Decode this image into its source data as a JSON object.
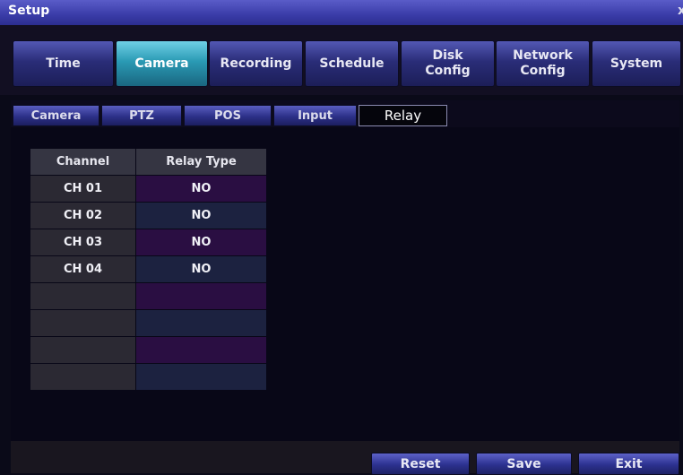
{
  "window": {
    "title": "Setup",
    "close_glyph": "x"
  },
  "main_tabs": [
    {
      "label": "Time",
      "active": false
    },
    {
      "label": "Camera",
      "active": true
    },
    {
      "label": "Recording",
      "active": false
    },
    {
      "label": "Schedule",
      "active": false
    },
    {
      "label": "Disk\nConfig",
      "active": false
    },
    {
      "label": "Network\nConfig",
      "active": false
    },
    {
      "label": "System",
      "active": false
    }
  ],
  "sub_tabs": [
    {
      "label": "Camera",
      "active": false
    },
    {
      "label": "PTZ",
      "active": false
    },
    {
      "label": "POS",
      "active": false
    },
    {
      "label": "Input",
      "active": false
    },
    {
      "label": "Relay",
      "active": true
    }
  ],
  "relay_table": {
    "headers": {
      "channel": "Channel",
      "relay_type": "Relay Type"
    },
    "rows": [
      {
        "channel": "CH 01",
        "relay_type": "NO"
      },
      {
        "channel": "CH 02",
        "relay_type": "NO"
      },
      {
        "channel": "CH 03",
        "relay_type": "NO"
      },
      {
        "channel": "CH 04",
        "relay_type": "NO"
      },
      {
        "channel": "",
        "relay_type": ""
      },
      {
        "channel": "",
        "relay_type": ""
      },
      {
        "channel": "",
        "relay_type": ""
      },
      {
        "channel": "",
        "relay_type": ""
      }
    ]
  },
  "buttons": {
    "reset": "Reset",
    "save": "Save",
    "exit": "Exit"
  },
  "colors": {
    "title_bar": "#3a3ca8",
    "active_tab": "#2a9ab4",
    "tab": "#2a2d78",
    "background": "#080717"
  }
}
